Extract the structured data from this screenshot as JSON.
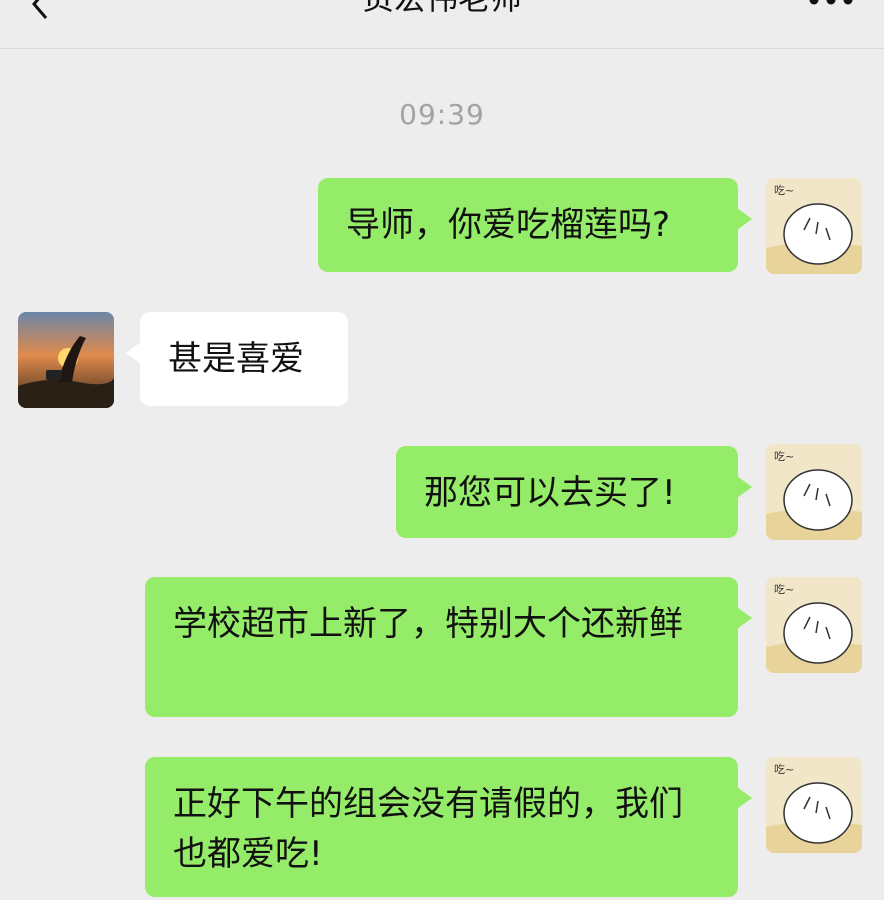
{
  "header": {
    "title": "贡宏伟老师",
    "back_icon": "chevron-left-icon",
    "more_icon": "more-dots-icon"
  },
  "timestamp": "09:39",
  "messages": [
    {
      "from": "me",
      "text": "导师，你爱吃榴莲吗?"
    },
    {
      "from": "teacher",
      "text": "甚是喜爱"
    },
    {
      "from": "me",
      "text": "那您可以去买了!"
    },
    {
      "from": "me",
      "text": "学校超市上新了，特别大个还新鲜"
    },
    {
      "from": "me",
      "text": "正好下午的组会没有请假的，我们也都爱吃!"
    }
  ],
  "avatar_text": "吃~",
  "colors": {
    "background": "#ededed",
    "my_bubble": "#95ec69",
    "their_bubble": "#ffffff",
    "timestamp": "#a3a3a3"
  }
}
